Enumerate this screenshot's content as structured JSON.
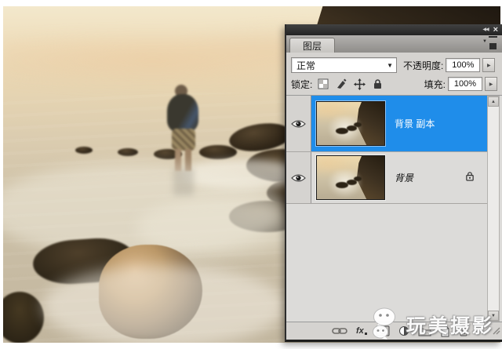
{
  "panel": {
    "tab": "图层",
    "blend_mode": "正常",
    "opacity_label": "不透明度:",
    "opacity_value": "100%",
    "lock_label": "锁定:",
    "fill_label": "填充:",
    "fill_value": "100%",
    "layers": [
      {
        "name": "背景 副本",
        "selected": true,
        "locked": false,
        "visible": true
      },
      {
        "name": "背景",
        "selected": false,
        "locked": true,
        "visible": true
      }
    ],
    "bottom_bar": {
      "fx_label": "fx"
    },
    "colors": {
      "selection_blue": "#1f8dea",
      "titlebar_dark": "#2b2b2b",
      "panel_bg": "#d5d3d0",
      "list_bg": "#dcdbd9"
    }
  },
  "icons": {
    "collapse": "◀◀",
    "close": "×",
    "dropdown_caret": "▼",
    "spinner_arrow": "▶",
    "scroll_up": "▲",
    "scroll_down": "▼"
  },
  "watermark": {
    "text": "玩美摄影"
  }
}
